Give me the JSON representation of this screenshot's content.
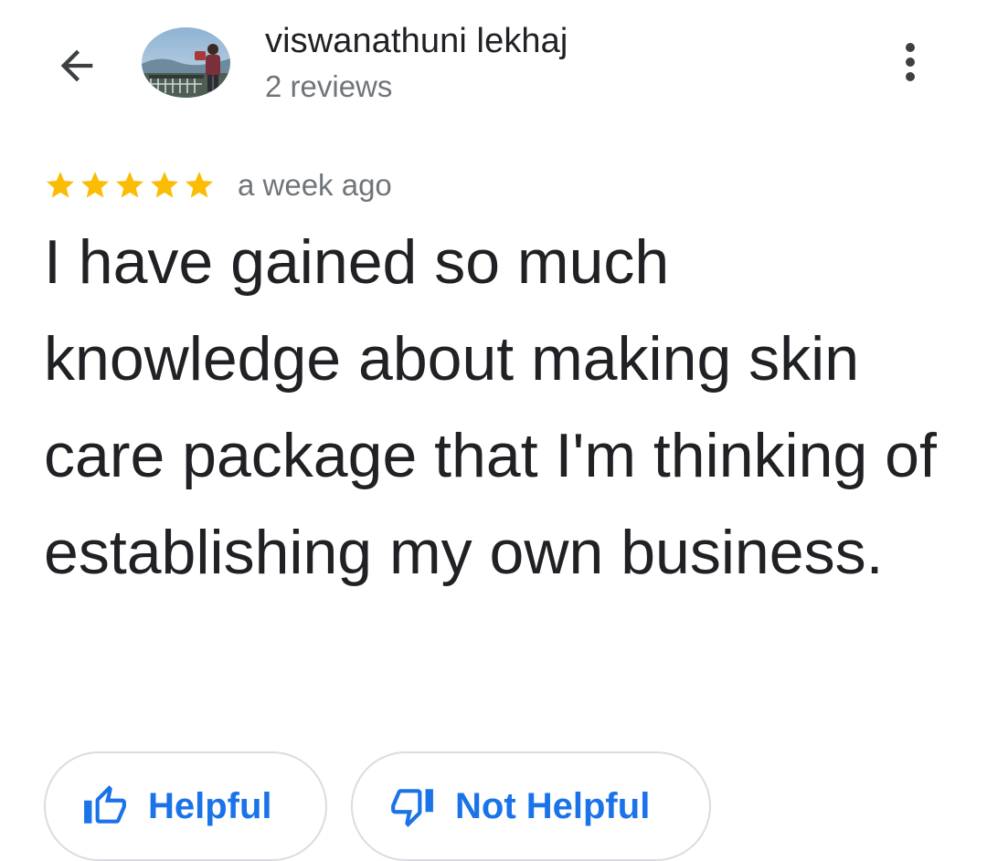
{
  "header": {
    "author_name": "viswanathuni lekhaj",
    "review_count": "2 reviews",
    "back_icon": "arrow-left-icon",
    "more_icon": "more-vert-icon"
  },
  "review": {
    "rating": 5,
    "max_rating": 5,
    "time_ago": "a week ago",
    "text": "I have gained so much knowledge about making skin care package that I'm thinking of establishing my own business."
  },
  "actions": {
    "helpful_label": "Helpful",
    "not_helpful_label": "Not Helpful",
    "helpful_icon": "thumb-up-icon",
    "not_helpful_icon": "thumb-down-icon"
  },
  "colors": {
    "star": "#fbbc04",
    "accent": "#1a73e8",
    "text_primary": "#202124",
    "text_secondary": "#70757a",
    "border": "#dadce0"
  }
}
